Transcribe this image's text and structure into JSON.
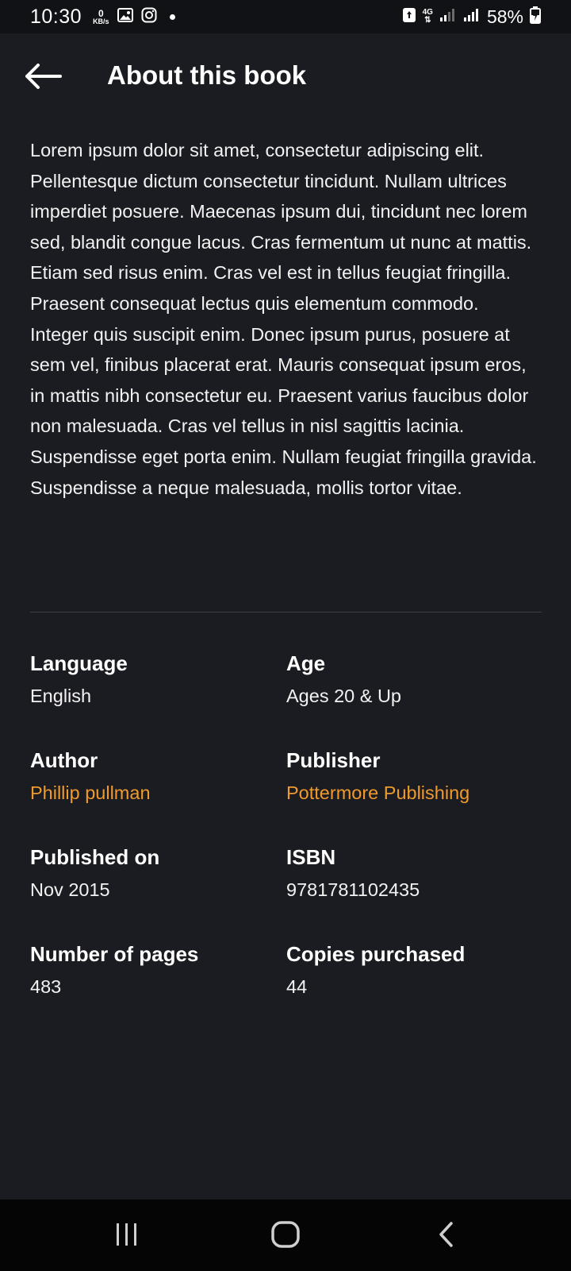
{
  "status_bar": {
    "time": "10:30",
    "net_speed_value": "0",
    "net_speed_unit": "KB/s",
    "network_type": "4G",
    "battery_percent": "58%"
  },
  "app_bar": {
    "title": "About this book"
  },
  "description": "Lorem ipsum dolor sit amet, consectetur adipiscing elit. Pellentesque dictum consectetur tincidunt. Nullam ultrices imperdiet posuere. Maecenas ipsum dui, tincidunt nec lorem sed, blandit congue lacus. Cras fermentum ut nunc at mattis. Etiam sed risus enim. Cras vel est in tellus feugiat fringilla. Praesent consequat lectus quis elementum commodo. Integer quis suscipit enim. Donec ipsum purus, posuere at sem vel, finibus placerat erat. Mauris consequat ipsum eros, in mattis nibh consectetur eu. Praesent varius faucibus dolor non malesuada. Cras vel tellus in nisl sagittis lacinia. Suspendisse eget porta enim. Nullam feugiat fringilla gravida. Suspendisse a neque malesuada, mollis tortor vitae.",
  "details": {
    "language": {
      "label": "Language",
      "value": "English"
    },
    "age": {
      "label": "Age",
      "value": "Ages 20 & Up"
    },
    "author": {
      "label": "Author",
      "value": "Phillip pullman"
    },
    "publisher": {
      "label": "Publisher",
      "value": "Pottermore Publishing"
    },
    "published_on": {
      "label": "Published on",
      "value": "Nov 2015"
    },
    "isbn": {
      "label": "ISBN",
      "value": "9781781102435"
    },
    "pages": {
      "label": "Number of pages",
      "value": "483"
    },
    "copies": {
      "label": "Copies purchased",
      "value": "44"
    }
  },
  "colors": {
    "background": "#1b1c21",
    "link_accent": "#ef9a2c",
    "divider": "#3c3e44"
  },
  "icons": {
    "back": "arrow-left-icon",
    "nav_recents": "recents-icon",
    "nav_home": "home-icon",
    "nav_back": "chevron-left-icon"
  }
}
